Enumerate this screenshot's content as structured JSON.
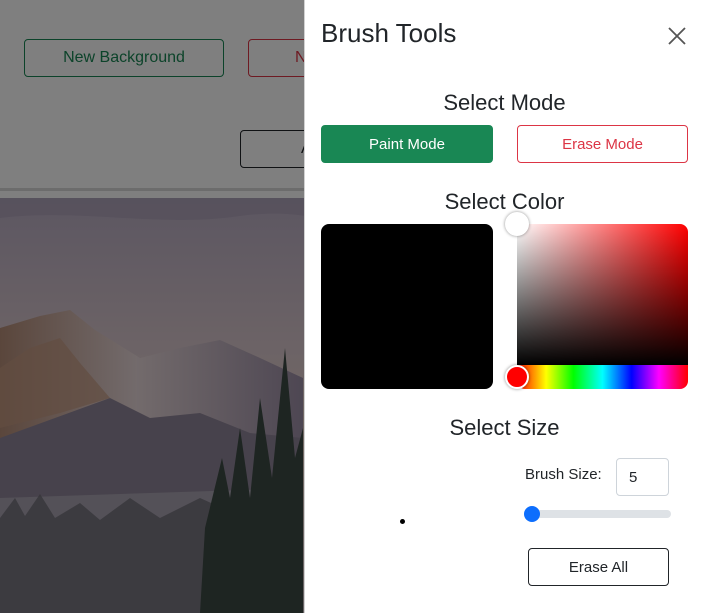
{
  "background": {
    "new_background_label": "New Background",
    "red_button_label": "N",
    "dark_button_label": "A"
  },
  "panel": {
    "title": "Brush Tools",
    "close_icon": "close-icon",
    "mode": {
      "heading": "Select Mode",
      "paint_label": "Paint Mode",
      "erase_label": "Erase Mode",
      "active": "paint"
    },
    "color": {
      "heading": "Select Color",
      "selected": "#000000",
      "hue": "#ff0000"
    },
    "size": {
      "heading": "Select Size",
      "brush_size_label": "Brush Size:",
      "brush_size_value": "5"
    },
    "erase_all_label": "Erase All"
  },
  "colors": {
    "success": "#198754",
    "danger": "#dc3545",
    "primary": "#0d6efd"
  }
}
